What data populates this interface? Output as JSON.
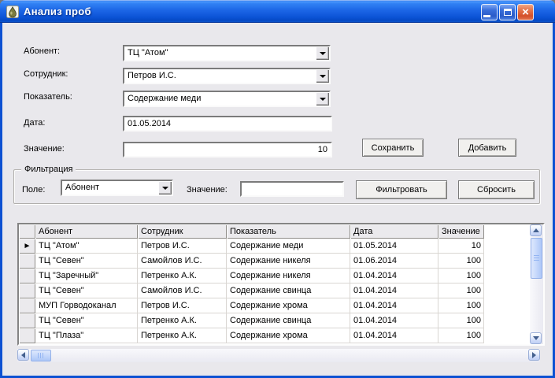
{
  "window": {
    "title": "Анализ проб"
  },
  "form": {
    "rows": [
      {
        "label": "Абонент:",
        "value": "ТЦ \"Атом\""
      },
      {
        "label": "Сотрудник:",
        "value": "Петров И.С."
      },
      {
        "label": "Показатель:",
        "value": "Содержание меди"
      },
      {
        "label": "Дата:",
        "value": "01.05.2014"
      },
      {
        "label": "Значение:",
        "value": "10"
      }
    ]
  },
  "buttons": {
    "save": "Сохранить",
    "add": "Добавить",
    "filter": "Фильтровать",
    "reset": "Сбросить"
  },
  "filter": {
    "group_title": "Фильтрация",
    "field_label": "Поле:",
    "field_value": "Абонент",
    "value_label": "Значение:",
    "value_text": ""
  },
  "grid": {
    "columns": [
      "Абонент",
      "Сотрудник",
      "Показатель",
      "Дата",
      "Значение"
    ],
    "rows": [
      [
        "ТЦ \"Атом\"",
        "Петров И.С.",
        "Содержание меди",
        "01.05.2014",
        "10"
      ],
      [
        "ТЦ \"Севен\"",
        "Самойлов И.С.",
        "Содержание никеля",
        "01.06.2014",
        "100"
      ],
      [
        "ТЦ \"Заречный\"",
        "Петренко А.К.",
        "Содержание никеля",
        "01.04.2014",
        "100"
      ],
      [
        "ТЦ \"Севен\"",
        "Самойлов И.С.",
        "Содержание свинца",
        "01.04.2014",
        "100"
      ],
      [
        "МУП Горводоканал",
        "Петров И.С.",
        "Содержание хрома",
        "01.04.2014",
        "100"
      ],
      [
        "ТЦ \"Севен\"",
        "Петренко А.К.",
        "Содержание свинца",
        "01.04.2014",
        "100"
      ],
      [
        "ТЦ \"Плаза\"",
        "Петренко А.К.",
        "Содержание хрома",
        "01.04.2014",
        "100"
      ]
    ],
    "selected_row_index": 0,
    "current_row_marker": "►"
  },
  "colors": {
    "titlebar_blue": "#1C66E6",
    "close_button_red": "#D4502A",
    "window_background": "#E9E8EC",
    "scrollbar_blue": "#C6D8FB"
  }
}
